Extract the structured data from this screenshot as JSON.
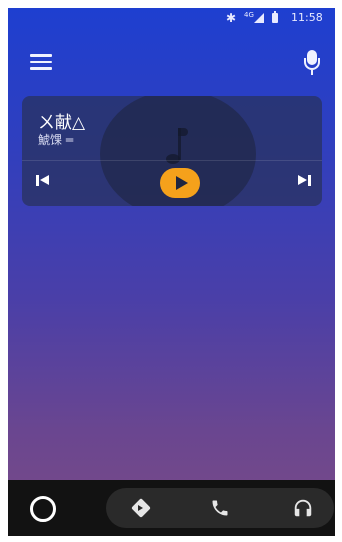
{
  "status_bar": {
    "bluetooth_icon": "bluetooth-icon",
    "network": "4G",
    "signal_icon": "cell-signal-icon",
    "battery_icon": "battery-icon",
    "time": "11:58"
  },
  "app_bar": {
    "menu_icon": "hamburger-menu-icon",
    "mic_icon": "microphone-icon"
  },
  "media": {
    "title": "ㄨ献△",
    "artist": "鯱馃 ═",
    "art_icon": "music-note-icon",
    "controls": {
      "previous_icon": "skip-previous-icon",
      "play_icon": "play-icon",
      "next_icon": "skip-next-icon",
      "play_color": "#f5a11b"
    }
  },
  "bottom_nav": {
    "home_icon": "home-circle-icon",
    "items": [
      {
        "icon": "navigation-icon"
      },
      {
        "icon": "phone-icon"
      },
      {
        "icon": "headphones-icon"
      }
    ]
  },
  "colors": {
    "background_top": "#1e3fd0",
    "background_bottom": "#7a4b86",
    "card": "#28325a",
    "bottom_bar": "#121212",
    "accent": "#f5a11b"
  }
}
